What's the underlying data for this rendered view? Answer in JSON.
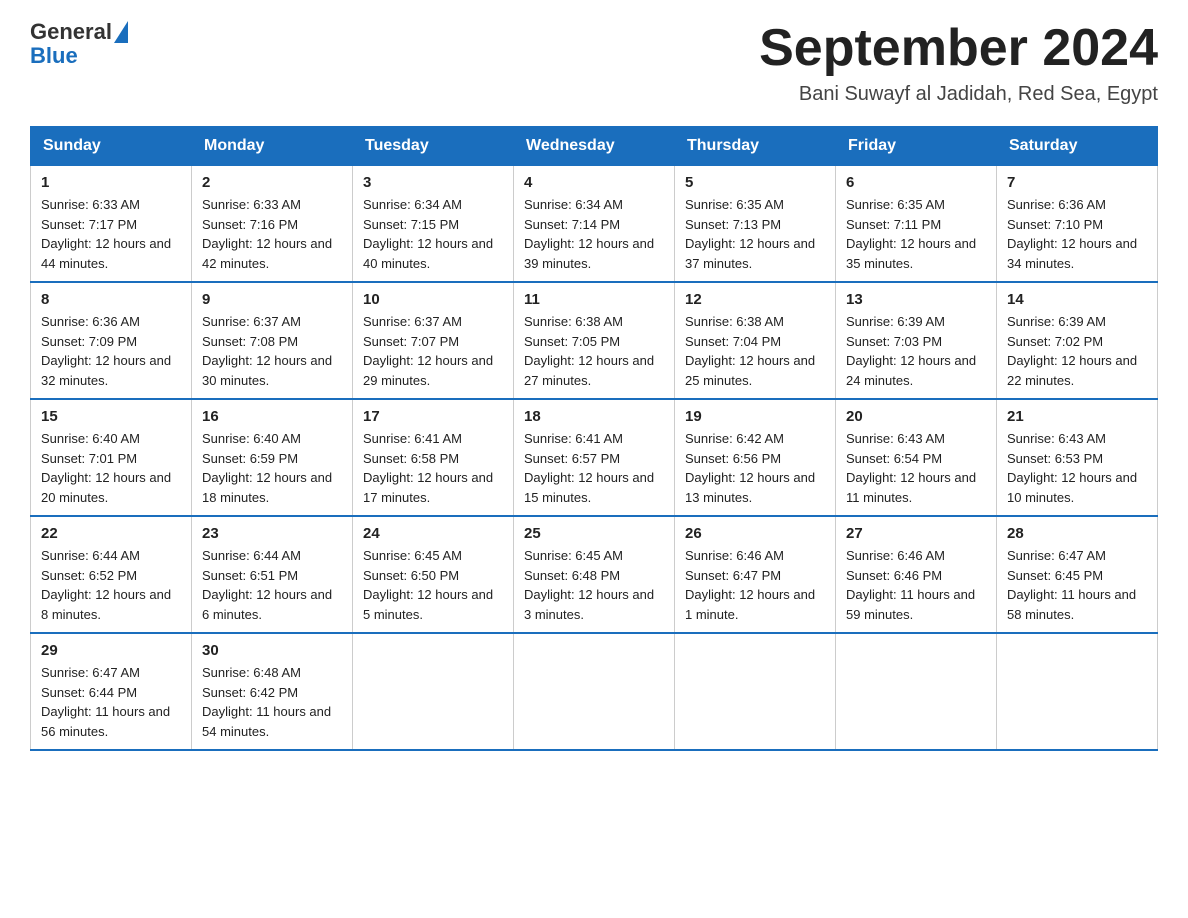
{
  "logo": {
    "text_general": "General",
    "text_blue": "Blue"
  },
  "header": {
    "title": "September 2024",
    "subtitle": "Bani Suwayf al Jadidah, Red Sea, Egypt"
  },
  "days_of_week": [
    "Sunday",
    "Monday",
    "Tuesday",
    "Wednesday",
    "Thursday",
    "Friday",
    "Saturday"
  ],
  "weeks": [
    [
      {
        "day": "1",
        "sunrise": "6:33 AM",
        "sunset": "7:17 PM",
        "daylight": "12 hours and 44 minutes."
      },
      {
        "day": "2",
        "sunrise": "6:33 AM",
        "sunset": "7:16 PM",
        "daylight": "12 hours and 42 minutes."
      },
      {
        "day": "3",
        "sunrise": "6:34 AM",
        "sunset": "7:15 PM",
        "daylight": "12 hours and 40 minutes."
      },
      {
        "day": "4",
        "sunrise": "6:34 AM",
        "sunset": "7:14 PM",
        "daylight": "12 hours and 39 minutes."
      },
      {
        "day": "5",
        "sunrise": "6:35 AM",
        "sunset": "7:13 PM",
        "daylight": "12 hours and 37 minutes."
      },
      {
        "day": "6",
        "sunrise": "6:35 AM",
        "sunset": "7:11 PM",
        "daylight": "12 hours and 35 minutes."
      },
      {
        "day": "7",
        "sunrise": "6:36 AM",
        "sunset": "7:10 PM",
        "daylight": "12 hours and 34 minutes."
      }
    ],
    [
      {
        "day": "8",
        "sunrise": "6:36 AM",
        "sunset": "7:09 PM",
        "daylight": "12 hours and 32 minutes."
      },
      {
        "day": "9",
        "sunrise": "6:37 AM",
        "sunset": "7:08 PM",
        "daylight": "12 hours and 30 minutes."
      },
      {
        "day": "10",
        "sunrise": "6:37 AM",
        "sunset": "7:07 PM",
        "daylight": "12 hours and 29 minutes."
      },
      {
        "day": "11",
        "sunrise": "6:38 AM",
        "sunset": "7:05 PM",
        "daylight": "12 hours and 27 minutes."
      },
      {
        "day": "12",
        "sunrise": "6:38 AM",
        "sunset": "7:04 PM",
        "daylight": "12 hours and 25 minutes."
      },
      {
        "day": "13",
        "sunrise": "6:39 AM",
        "sunset": "7:03 PM",
        "daylight": "12 hours and 24 minutes."
      },
      {
        "day": "14",
        "sunrise": "6:39 AM",
        "sunset": "7:02 PM",
        "daylight": "12 hours and 22 minutes."
      }
    ],
    [
      {
        "day": "15",
        "sunrise": "6:40 AM",
        "sunset": "7:01 PM",
        "daylight": "12 hours and 20 minutes."
      },
      {
        "day": "16",
        "sunrise": "6:40 AM",
        "sunset": "6:59 PM",
        "daylight": "12 hours and 18 minutes."
      },
      {
        "day": "17",
        "sunrise": "6:41 AM",
        "sunset": "6:58 PM",
        "daylight": "12 hours and 17 minutes."
      },
      {
        "day": "18",
        "sunrise": "6:41 AM",
        "sunset": "6:57 PM",
        "daylight": "12 hours and 15 minutes."
      },
      {
        "day": "19",
        "sunrise": "6:42 AM",
        "sunset": "6:56 PM",
        "daylight": "12 hours and 13 minutes."
      },
      {
        "day": "20",
        "sunrise": "6:43 AM",
        "sunset": "6:54 PM",
        "daylight": "12 hours and 11 minutes."
      },
      {
        "day": "21",
        "sunrise": "6:43 AM",
        "sunset": "6:53 PM",
        "daylight": "12 hours and 10 minutes."
      }
    ],
    [
      {
        "day": "22",
        "sunrise": "6:44 AM",
        "sunset": "6:52 PM",
        "daylight": "12 hours and 8 minutes."
      },
      {
        "day": "23",
        "sunrise": "6:44 AM",
        "sunset": "6:51 PM",
        "daylight": "12 hours and 6 minutes."
      },
      {
        "day": "24",
        "sunrise": "6:45 AM",
        "sunset": "6:50 PM",
        "daylight": "12 hours and 5 minutes."
      },
      {
        "day": "25",
        "sunrise": "6:45 AM",
        "sunset": "6:48 PM",
        "daylight": "12 hours and 3 minutes."
      },
      {
        "day": "26",
        "sunrise": "6:46 AM",
        "sunset": "6:47 PM",
        "daylight": "12 hours and 1 minute."
      },
      {
        "day": "27",
        "sunrise": "6:46 AM",
        "sunset": "6:46 PM",
        "daylight": "11 hours and 59 minutes."
      },
      {
        "day": "28",
        "sunrise": "6:47 AM",
        "sunset": "6:45 PM",
        "daylight": "11 hours and 58 minutes."
      }
    ],
    [
      {
        "day": "29",
        "sunrise": "6:47 AM",
        "sunset": "6:44 PM",
        "daylight": "11 hours and 56 minutes."
      },
      {
        "day": "30",
        "sunrise": "6:48 AM",
        "sunset": "6:42 PM",
        "daylight": "11 hours and 54 minutes."
      },
      null,
      null,
      null,
      null,
      null
    ]
  ]
}
